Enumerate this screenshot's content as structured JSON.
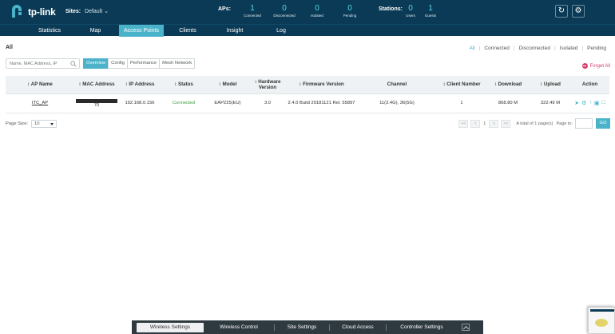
{
  "header": {
    "logo_text": "tp-link",
    "sites_label": "Sites:",
    "sites_value": "Default",
    "aps_label": "APs:",
    "ap_stats": [
      {
        "num": "1",
        "label": "Connected"
      },
      {
        "num": "0",
        "label": "Disconnected"
      },
      {
        "num": "0",
        "label": "Isolated"
      },
      {
        "num": "0",
        "label": "Pending"
      }
    ],
    "stations_label": "Stations:",
    "station_stats": [
      {
        "num": "0",
        "label": "Users"
      },
      {
        "num": "1",
        "label": "Guests"
      }
    ]
  },
  "nav": {
    "items": [
      "Statistics",
      "Map",
      "Access Points",
      "Clients",
      "Insight",
      "Log"
    ],
    "active": "Access Points"
  },
  "main": {
    "section_title": "All",
    "filters": [
      "All",
      "Connected",
      "Disconnected",
      "Isolated",
      "Pending"
    ],
    "active_filter": "All",
    "search_placeholder": "Name, MAC Address, IP",
    "tabs": [
      "Overview",
      "Config",
      "Performance",
      "Mesh Network"
    ],
    "active_tab": "Overview",
    "forget_all_label": "Forget All",
    "columns": [
      "↕ AP Name",
      "↕ MAC Address",
      "↕ IP Address",
      "↕ Status",
      "↕ Model",
      "↕ Hardware Version",
      "↕ Firmware Version",
      "Channel",
      "↕ Client Number",
      "↕ Download",
      "↕ Upload",
      "Action"
    ],
    "rows": [
      {
        "ap_name": "ITC_AP",
        "mac_suffix": "70",
        "ip": "192.168.0.156",
        "status": "Connected",
        "model": "EAP225(EU)",
        "hw_version": "3.0",
        "fw_version": "2.4.0 Build 20181121 Rel. 55897",
        "channel": "11(2.4G), 36(5G)",
        "client_number": "1",
        "download": "868.80 M",
        "upload": "322.49 M"
      }
    ],
    "page_size_label": "Page Size:",
    "page_size_value": "10",
    "pager": {
      "first": "<<",
      "prev": "<",
      "current": "1",
      "next": ">",
      "last": ">>",
      "total_text": "A total of 1 page(s)",
      "page_to_label": "Page to:",
      "go_label": "GO"
    }
  },
  "dock": {
    "items": [
      "Wireless Settings",
      "Wireless Control",
      "Site Settings",
      "Cloud Access",
      "Controller Settings"
    ],
    "active": "Wireless Settings"
  },
  "colors": {
    "header_bg": "#0a3a55",
    "accent": "#4ab3c9",
    "stat_number": "#58d6e6",
    "status_ok": "#3a9b3a",
    "danger": "#d33f6b"
  }
}
